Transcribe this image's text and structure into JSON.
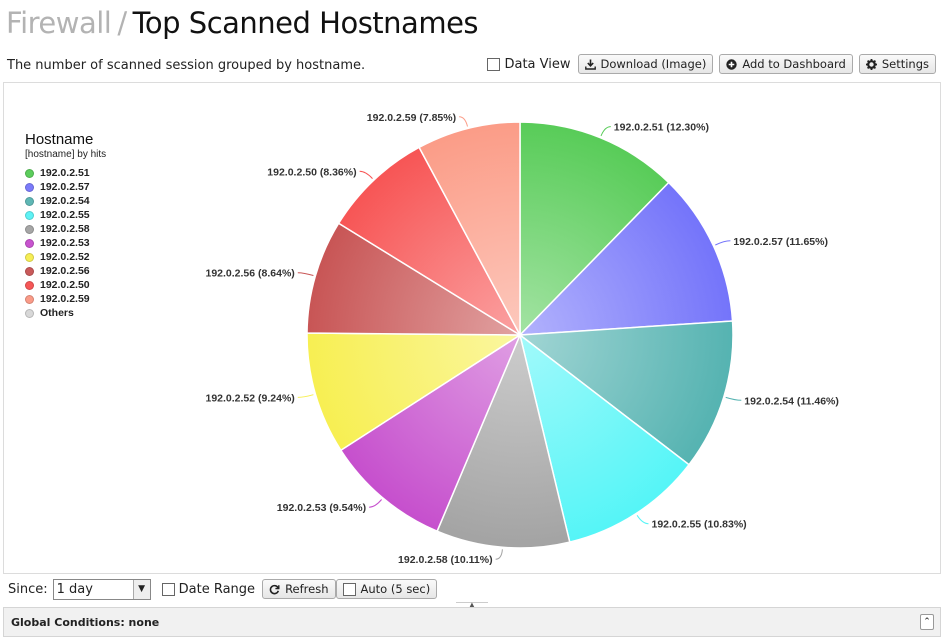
{
  "breadcrumb": {
    "parent": "Firewall",
    "separator": "/",
    "title": "Top Scanned Hostnames"
  },
  "subtitle": "The number of scanned session grouped by hostname.",
  "toolbar": {
    "data_view_label": "Data View",
    "download_label": "Download (Image)",
    "add_dashboard_label": "Add to Dashboard",
    "settings_label": "Settings",
    "download_icon": "download-icon",
    "add_icon": "plus-circle-icon",
    "settings_icon": "gear-icon"
  },
  "legend": {
    "title": "Hostname",
    "subtitle": "[hostname] by hits",
    "items": [
      {
        "label": "192.0.2.51",
        "color": "#5ccd5c"
      },
      {
        "label": "192.0.2.57",
        "color": "#7b7bfa"
      },
      {
        "label": "192.0.2.54",
        "color": "#5fb7b5"
      },
      {
        "label": "192.0.2.55",
        "color": "#5ef2f5"
      },
      {
        "label": "192.0.2.58",
        "color": "#a6a6a6"
      },
      {
        "label": "192.0.2.53",
        "color": "#c854cf"
      },
      {
        "label": "192.0.2.52",
        "color": "#f6ee55"
      },
      {
        "label": "192.0.2.56",
        "color": "#c95a5a"
      },
      {
        "label": "192.0.2.50",
        "color": "#f65757"
      },
      {
        "label": "192.0.2.59",
        "color": "#fa9b88"
      },
      {
        "label": "Others",
        "color": "#d8d8d8"
      }
    ]
  },
  "chart_data": {
    "type": "pie",
    "slices": [
      {
        "label": "192.0.2.51",
        "value": 12.3,
        "display": "192.0.2.51 (12.30%)",
        "color": "#58cc58"
      },
      {
        "label": "192.0.2.57",
        "value": 11.65,
        "display": "192.0.2.57 (11.65%)",
        "color": "#7474fa"
      },
      {
        "label": "192.0.2.54",
        "value": 11.46,
        "display": "192.0.2.54 (11.46%)",
        "color": "#55b3b1"
      },
      {
        "label": "192.0.2.55",
        "value": 10.83,
        "display": "192.0.2.55 (10.83%)",
        "color": "#55f5f7"
      },
      {
        "label": "192.0.2.58",
        "value": 10.11,
        "display": "192.0.2.58 (10.11%)",
        "color": "#a3a3a3"
      },
      {
        "label": "192.0.2.53",
        "value": 9.54,
        "display": "192.0.2.53 (9.54%)",
        "color": "#c64fcd"
      },
      {
        "label": "192.0.2.52",
        "value": 9.24,
        "display": "192.0.2.52 (9.24%)",
        "color": "#f7ef52"
      },
      {
        "label": "192.0.2.56",
        "value": 8.64,
        "display": "192.0.2.56 (8.64%)",
        "color": "#c85555"
      },
      {
        "label": "192.0.2.50",
        "value": 8.36,
        "display": "192.0.2.50 (8.36%)",
        "color": "#f75555"
      },
      {
        "label": "192.0.2.59",
        "value": 7.85,
        "display": "192.0.2.59 (7.85%)",
        "color": "#fb9c87"
      }
    ],
    "legend_position": "left"
  },
  "controls": {
    "since_label": "Since:",
    "since_value": "1 day",
    "date_range_label": "Date Range",
    "refresh_label": "Refresh",
    "auto_label": "Auto (5 sec)",
    "refresh_icon": "refresh-icon"
  },
  "footer": {
    "global_conditions": "Global Conditions: none"
  }
}
